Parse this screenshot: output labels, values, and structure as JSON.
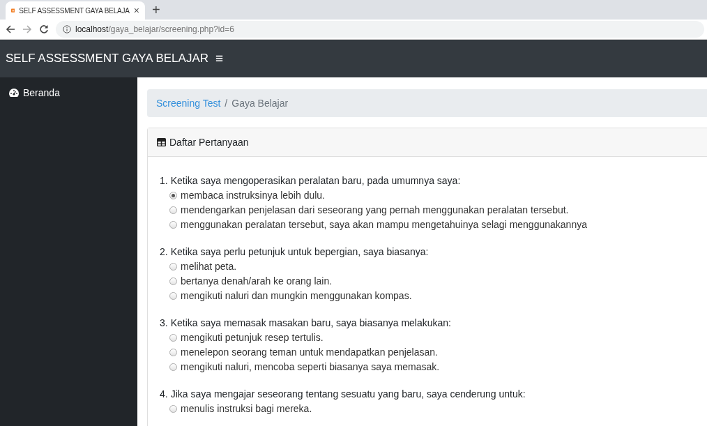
{
  "browser": {
    "tab_title": "SELF ASSESSMENT GAYA BELAJA",
    "tab_close": "×",
    "new_tab": "+",
    "url_host": "localhost",
    "url_path": "/gaya_belajar/screening.php?id=6"
  },
  "navbar": {
    "brand": "SELF ASSESSMENT GAYA BELAJAR",
    "menu_toggle": "≡"
  },
  "sidebar": {
    "items": [
      {
        "label": "Beranda"
      }
    ]
  },
  "breadcrumb": {
    "separator": "/",
    "items": [
      {
        "label": "Screening Test",
        "kind": "link"
      },
      {
        "label": "Gaya Belajar",
        "kind": "current"
      }
    ]
  },
  "card": {
    "title": "Daftar Pertanyaan"
  },
  "questions": [
    {
      "number": "1.",
      "text": "Ketika saya mengoperasikan peralatan baru, pada umumnya saya:",
      "options": [
        {
          "label": "membaca instruksinya lebih dulu.",
          "selected": true
        },
        {
          "label": "mendengarkan penjelasan dari seseorang yang pernah menggunakan peralatan tersebut.",
          "selected": false
        },
        {
          "label": "menggunakan peralatan tersebut, saya akan mampu mengetahuinya selagi menggunakannya",
          "selected": false
        }
      ]
    },
    {
      "number": "2.",
      "text": "Ketika saya perlu petunjuk untuk bepergian, saya biasanya:",
      "options": [
        {
          "label": "melihat peta.",
          "selected": false
        },
        {
          "label": "bertanya denah/arah ke orang lain.",
          "selected": false
        },
        {
          "label": "mengikuti naluri dan mungkin menggunakan kompas.",
          "selected": false
        }
      ]
    },
    {
      "number": "3.",
      "text": "Ketika saya memasak masakan baru, saya biasanya melakukan:",
      "options": [
        {
          "label": "mengikuti petunjuk resep tertulis.",
          "selected": false
        },
        {
          "label": "menelepon seorang teman untuk mendapatkan penjelasan.",
          "selected": false
        },
        {
          "label": "mengikuti naluri, mencoba seperti biasanya saya memasak.",
          "selected": false
        }
      ]
    },
    {
      "number": "4.",
      "text": "Jika saya mengajar seseorang tentang sesuatu yang baru, saya cenderung untuk:",
      "options": [
        {
          "label": "menulis instruksi bagi mereka.",
          "selected": false
        }
      ]
    }
  ]
}
